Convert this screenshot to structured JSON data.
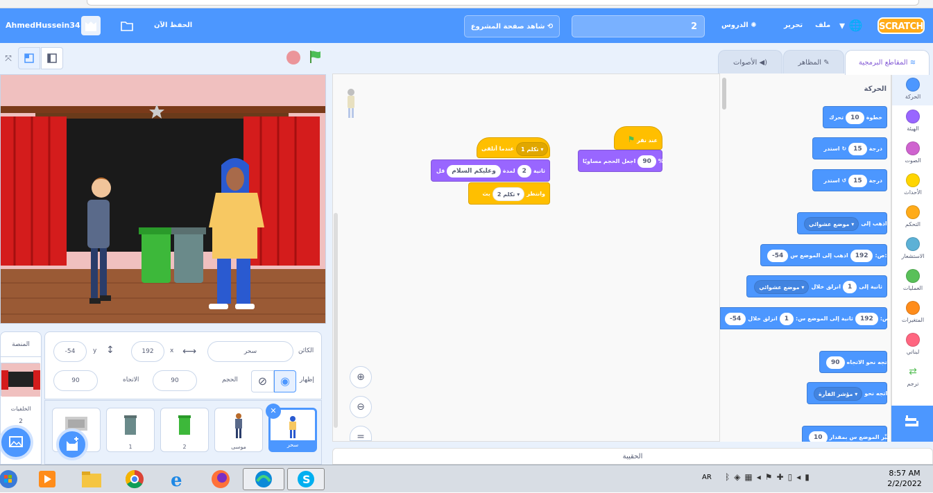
{
  "menu": {
    "user": "AhmedHussein34",
    "save_now": "الحفظ الآن",
    "see_project": "شاهد صفحة المشروع",
    "project_title": "2",
    "tutorials": "الدروس",
    "edit": "تحرير",
    "file": "ملف",
    "logo": "SCRATCH"
  },
  "tabs": {
    "code": "المقاطع البرمجية",
    "costumes": "المظاهر",
    "sounds": "الأصوات"
  },
  "categories": [
    {
      "label": "الحركة",
      "color": "#4c97ff"
    },
    {
      "label": "الهيئة",
      "color": "#9966ff"
    },
    {
      "label": "الصوت",
      "color": "#cf63cf"
    },
    {
      "label": "الأحداث",
      "color": "#ffd500"
    },
    {
      "label": "التحكم",
      "color": "#ffab19"
    },
    {
      "label": "الاستشعار",
      "color": "#5cb1d6"
    },
    {
      "label": "العمليات",
      "color": "#59c059"
    },
    {
      "label": "المتغيرات",
      "color": "#ff8c1a"
    },
    {
      "label": "لبناتي",
      "color": "#ff6680"
    },
    {
      "label": "ترجم",
      "color": "#ffffff"
    }
  ],
  "palette": {
    "heading": "الحركة",
    "move": {
      "a": "تحرك",
      "v": "10",
      "b": "خطوة"
    },
    "turn_r": {
      "a": "استدر",
      "v": "15",
      "b": "درجة"
    },
    "turn_l": {
      "a": "استدر",
      "v": "15",
      "b": "درجة"
    },
    "goto_random": {
      "a": "اذهب إلى",
      "d": "موضع عشوائي"
    },
    "goto_xy": {
      "a": "اذهب إلى الموضع س:",
      "x": "192",
      "b": "ص:",
      "y": "-54"
    },
    "glide_random": {
      "a": "انزلق خلال",
      "v": "1",
      "b": "ثانية إلى",
      "d": "موضع عشوائي"
    },
    "glide_xy": {
      "a": "انزلق خلال",
      "v": "1",
      "b": "ثانية إلى الموضع س:",
      "x": "192",
      "c": "ص:",
      "y": "-54"
    },
    "point_dir": {
      "a": "اتجه نحو الاتجاه",
      "v": "90"
    },
    "point_towards": {
      "a": "اتجه نحو",
      "d": "مؤشر الفأرة"
    },
    "change_x": {
      "a": "غيِّر الموضع س بمقدار",
      "v": "10"
    }
  },
  "script1": {
    "when_receive": "عندما أتلقى",
    "msg1": "تكلم 1",
    "say": "قل",
    "say_text": "وعليكم السلام",
    "for": "لمدة",
    "secs": "2",
    "secs_unit": "ثانية",
    "broadcast": "بث",
    "msg2": "تكلم 2",
    "and_wait": "وانتظر"
  },
  "script2": {
    "when_flag": "عند نقر",
    "set_size": "اجعل الحجم مساويًا",
    "size": "90",
    "pct": "%"
  },
  "backpack": "الحقيبة",
  "sprite": {
    "label_name": "الكائن",
    "name": "سحر",
    "x_label": "x",
    "x": "192",
    "y_label": "y",
    "y": "-54",
    "show": "إظهار",
    "size_label": "الحجم",
    "size": "90",
    "dir_label": "الاتجاه",
    "dir": "90"
  },
  "stage_panel": {
    "title": "المنصة",
    "backdrops_label": "الخلفيات",
    "backdrops_count": "2"
  },
  "sprites": [
    {
      "name": "سحر",
      "selected": true
    },
    {
      "name": "موسى"
    },
    {
      "name": "2"
    },
    {
      "name": "1"
    },
    {
      "name": ""
    }
  ],
  "clock": {
    "time": "8:57 AM",
    "date": "2/2/2022"
  },
  "lang": "AR",
  "colors": {
    "accent": "#4c97ff",
    "motion": "#4c97ff",
    "looks": "#9966ff",
    "events": "#ffbf00"
  }
}
